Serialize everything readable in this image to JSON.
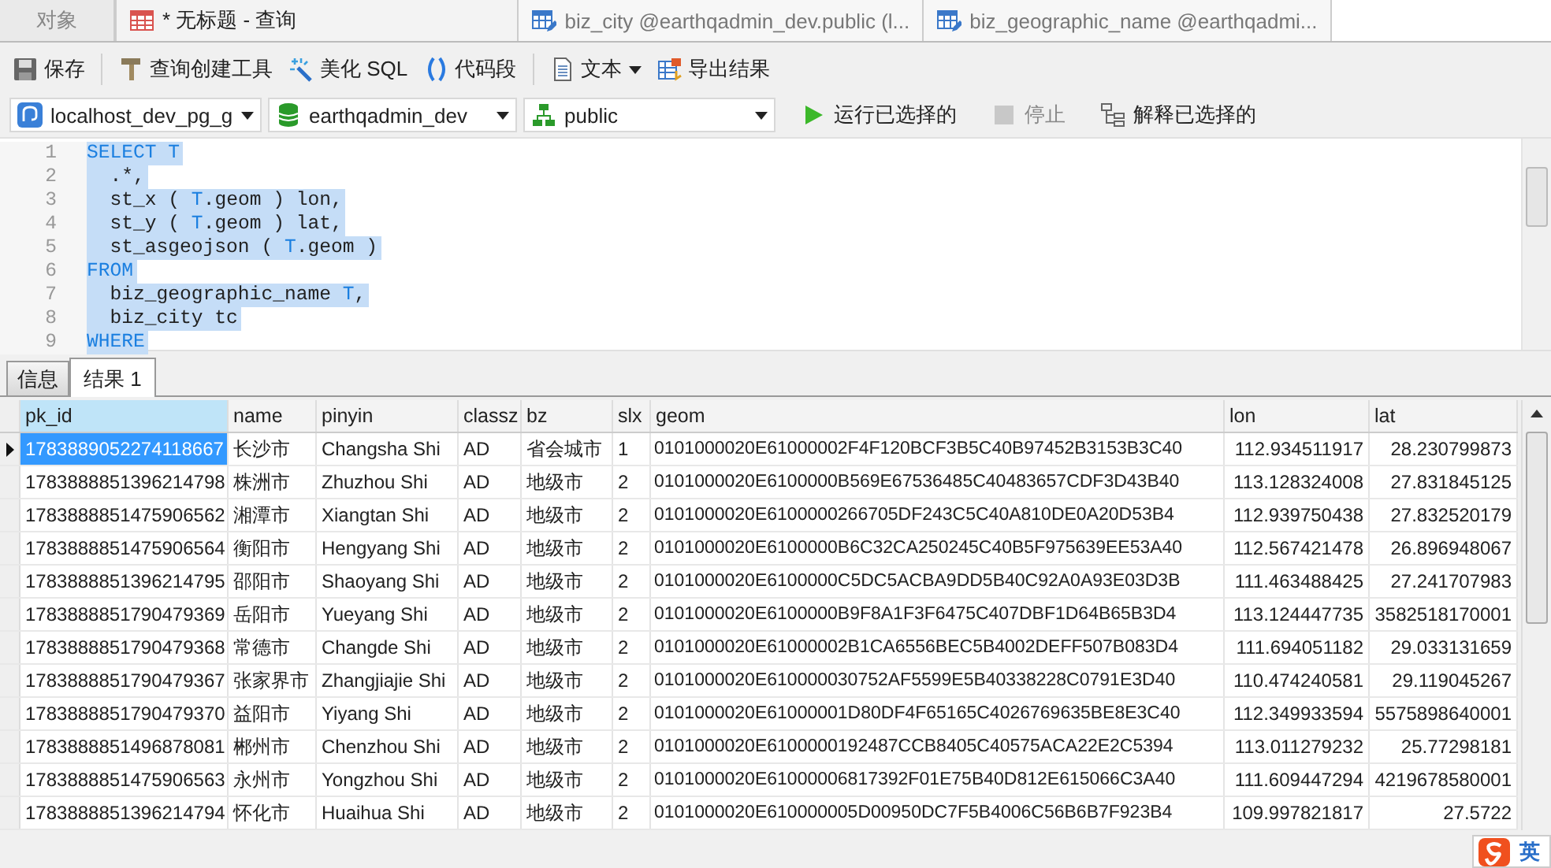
{
  "tabs": [
    {
      "label": "对象",
      "kind": "plain",
      "selected": false
    },
    {
      "label": "* 无标题 - 查询",
      "kind": "query",
      "selected": true
    },
    {
      "label": "biz_city @earthqadmin_dev.public (l...",
      "kind": "table",
      "selected": false
    },
    {
      "label": "biz_geographic_name @earthqadmi...",
      "kind": "table",
      "selected": false
    }
  ],
  "toolbar": [
    {
      "label": "保存",
      "kind": "save"
    },
    {
      "label": "查询创建工具",
      "kind": "builder"
    },
    {
      "label": "美化 SQL",
      "kind": "beautify"
    },
    {
      "label": "代码段",
      "kind": "snippet"
    },
    {
      "label": "文本",
      "kind": "text"
    },
    {
      "label": "导出结果",
      "kind": "export"
    }
  ],
  "connection": {
    "server": "localhost_dev_pg_g",
    "database": "earthqadmin_dev",
    "schema": "public"
  },
  "actions": [
    {
      "label": "运行已选择的",
      "kind": "run",
      "disabled": false
    },
    {
      "label": "停止",
      "kind": "stop",
      "disabled": true
    },
    {
      "label": "解释已选择的",
      "kind": "explain",
      "disabled": false
    }
  ],
  "editor": {
    "lines": [
      {
        "number": "1",
        "selected": true,
        "tokens": [
          {
            "text": "SELECT T",
            "kind": "keyword"
          }
        ]
      },
      {
        "number": "2",
        "selected": true,
        "tokens": [
          {
            "text": "  .*,",
            "kind": "plain"
          }
        ]
      },
      {
        "number": "3",
        "selected": true,
        "tokens": [
          {
            "text": "  st_x ( ",
            "kind": "plain"
          },
          {
            "text": "T",
            "kind": "keyword"
          },
          {
            "text": ".geom ) lon,",
            "kind": "plain"
          }
        ]
      },
      {
        "number": "4",
        "selected": true,
        "tokens": [
          {
            "text": "  st_y ( ",
            "kind": "plain"
          },
          {
            "text": "T",
            "kind": "keyword"
          },
          {
            "text": ".geom ) lat,",
            "kind": "plain"
          }
        ]
      },
      {
        "number": "5",
        "selected": true,
        "tokens": [
          {
            "text": "  st_asgeojson ( ",
            "kind": "plain"
          },
          {
            "text": "T",
            "kind": "keyword"
          },
          {
            "text": ".geom )",
            "kind": "plain"
          }
        ]
      },
      {
        "number": "6",
        "selected": true,
        "tokens": [
          {
            "text": "FROM",
            "kind": "keyword"
          }
        ]
      },
      {
        "number": "7",
        "selected": true,
        "tokens": [
          {
            "text": "  biz_geographic_name ",
            "kind": "plain"
          },
          {
            "text": "T",
            "kind": "keyword"
          },
          {
            "text": ",",
            "kind": "plain"
          }
        ]
      },
      {
        "number": "8",
        "selected": true,
        "tokens": [
          {
            "text": "  biz_city tc",
            "kind": "plain"
          }
        ]
      },
      {
        "number": "9",
        "selected": true,
        "tokens": [
          {
            "text": "WHERE",
            "kind": "keyword"
          }
        ]
      }
    ]
  },
  "result_tabs": [
    {
      "label": "信息",
      "selected": false
    },
    {
      "label": "结果 1",
      "selected": true
    }
  ],
  "table": {
    "columns": [
      {
        "label": "pk_id",
        "kind": "text",
        "selected": true
      },
      {
        "label": "name",
        "kind": "text",
        "selected": false
      },
      {
        "label": "pinyin",
        "kind": "text",
        "selected": false
      },
      {
        "label": "classz",
        "kind": "text",
        "selected": false
      },
      {
        "label": "bz",
        "kind": "text",
        "selected": false
      },
      {
        "label": "slx",
        "kind": "text",
        "selected": false
      },
      {
        "label": "geom",
        "kind": "text",
        "selected": false
      },
      {
        "label": "lon",
        "kind": "number",
        "selected": false
      },
      {
        "label": "lat",
        "kind": "number",
        "selected": false
      }
    ],
    "rows": [
      {
        "selected": true,
        "cells": [
          "1783889052274118667",
          "长沙市",
          "Changsha Shi",
          "AD",
          "省会城市",
          "1",
          "0101000020E61000002F4F120BCF3B5C40B97452B3153B3C40",
          "112.934511917",
          "28.230799873"
        ]
      },
      {
        "selected": false,
        "cells": [
          "1783888851396214798",
          "株洲市",
          "Zhuzhou Shi",
          "AD",
          "地级市",
          "2",
          "0101000020E6100000B569E67536485C40483657CDF3D43B40",
          "113.128324008",
          "27.831845125"
        ]
      },
      {
        "selected": false,
        "cells": [
          "1783888851475906562",
          "湘潭市",
          "Xiangtan Shi",
          "AD",
          "地级市",
          "2",
          "0101000020E6100000266705DF243C5C40A810DE0A20D53B4",
          "112.939750438",
          "27.832520179"
        ]
      },
      {
        "selected": false,
        "cells": [
          "1783888851475906564",
          "衡阳市",
          "Hengyang Shi",
          "AD",
          "地级市",
          "2",
          "0101000020E6100000B6C32CA250245C40B5F975639EE53A40",
          "112.567421478",
          "26.896948067"
        ]
      },
      {
        "selected": false,
        "cells": [
          "1783888851396214795",
          "邵阳市",
          "Shaoyang Shi",
          "AD",
          "地级市",
          "2",
          "0101000020E6100000C5DC5ACBA9DD5B40C92A0A93E03D3B",
          "111.463488425",
          "27.241707983"
        ]
      },
      {
        "selected": false,
        "cells": [
          "1783888851790479369",
          "岳阳市",
          "Yueyang Shi",
          "AD",
          "地级市",
          "2",
          "0101000020E6100000B9F8A1F3F6475C407DBF1D64B65B3D4",
          "113.124447735",
          "3582518170001"
        ]
      },
      {
        "selected": false,
        "cells": [
          "1783888851790479368",
          "常德市",
          "Changde Shi",
          "AD",
          "地级市",
          "2",
          "0101000020E61000002B1CA6556BEC5B4002DEFF507B083D4",
          "111.694051182",
          "29.033131659"
        ]
      },
      {
        "selected": false,
        "cells": [
          "1783888851790479367",
          "张家界市",
          "Zhangjiajie Shi",
          "AD",
          "地级市",
          "2",
          "0101000020E610000030752AF5599E5B40338228C0791E3D40",
          "110.474240581",
          "29.119045267"
        ]
      },
      {
        "selected": false,
        "cells": [
          "1783888851790479370",
          "益阳市",
          "Yiyang Shi",
          "AD",
          "地级市",
          "2",
          "0101000020E61000001D80DF4F65165C4026769635BE8E3C40",
          "112.349933594",
          "5575898640001"
        ]
      },
      {
        "selected": false,
        "cells": [
          "1783888851496878081",
          "郴州市",
          "Chenzhou Shi",
          "AD",
          "地级市",
          "2",
          "0101000020E6100000192487CCB8405C40575ACA22E2C5394",
          "113.011279232",
          "25.77298181"
        ]
      },
      {
        "selected": false,
        "cells": [
          "1783888851475906563",
          "永州市",
          "Yongzhou Shi",
          "AD",
          "地级市",
          "2",
          "0101000020E61000006817392F01E75B40D812E615066C3A40",
          "111.609447294",
          "4219678580001"
        ]
      },
      {
        "selected": false,
        "cells": [
          "1783888851396214794",
          "怀化市",
          "Huaihua Shi",
          "AD",
          "地级市",
          "2",
          "0101000020E610000005D00950DC7F5B4006C56B6B7F923B4",
          "109.997821817",
          "27.5722"
        ]
      }
    ]
  },
  "ime": {
    "mode": "英"
  }
}
